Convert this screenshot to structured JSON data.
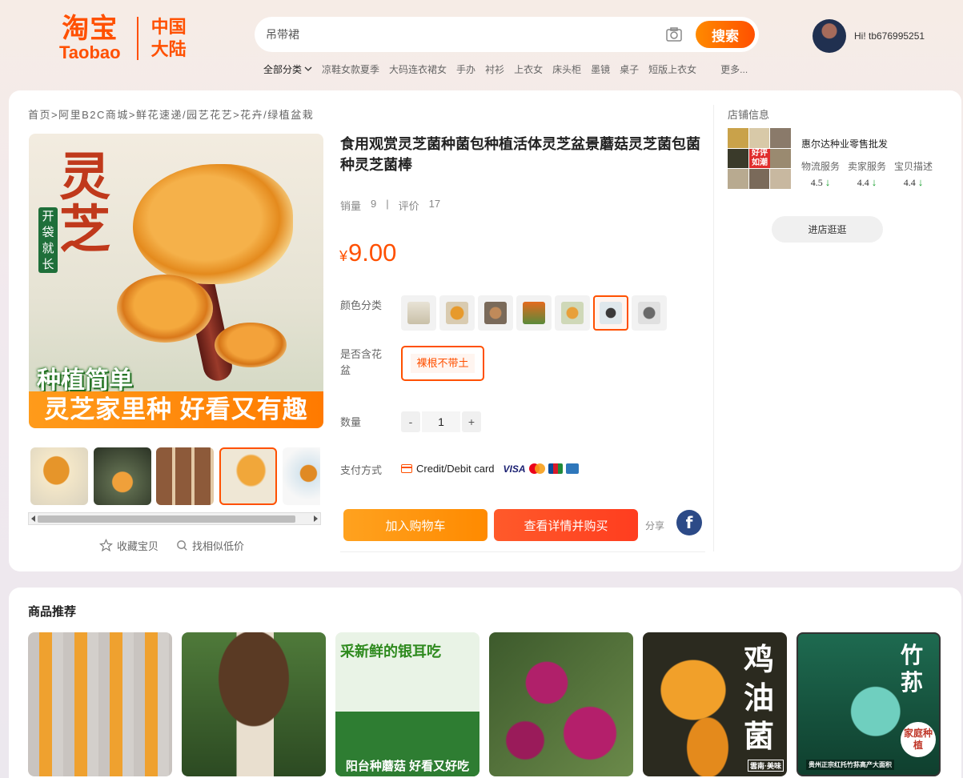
{
  "header": {
    "logo_cn": "淘宝",
    "logo_en": "Taobao",
    "region": [
      "中国",
      "大陆"
    ],
    "search_placeholder": "吊带裙",
    "search_button": "搜索",
    "categories_all": "全部分类",
    "keywords": [
      "凉鞋女款夏季",
      "大码连衣裙女",
      "手办",
      "衬衫",
      "上衣女",
      "床头柜",
      "墨镜",
      "桌子",
      "短版上衣女"
    ],
    "more": "更多...",
    "user_greeting": "Hi! tb676995251"
  },
  "breadcrumb": "首页>阿里B2C商城>鲜花速递/园艺花艺>花卉/绿植盆栽",
  "main_image": {
    "sign": "开袋就长",
    "title": "灵芝",
    "slogan": "种植简单",
    "banner": "灵芝家里种 好看又有趣"
  },
  "thumbnail_count": 5,
  "selected_thumbnail": 4,
  "favorite": "收藏宝贝",
  "similar": "找相似低价",
  "product": {
    "title": "食用观赏灵芝菌种菌包种植活体灵芝盆景蘑菇灵芝菌包菌种灵芝菌棒",
    "sales_label": "销量",
    "sales_value": "9",
    "reviews_label": "评价",
    "reviews_value": "17",
    "currency": "¥",
    "price": "9.00",
    "color_label": "颜色分类",
    "swatch_count": 7,
    "selected_swatch": 6,
    "pot_label": "是否含花盆",
    "pot_option": "裸根不带土",
    "qty_label": "数量",
    "qty_minus": "-",
    "qty_value": "1",
    "qty_plus": "+",
    "pay_label": "支付方式",
    "pay_method": "Credit/Debit card",
    "visa": "VISA",
    "add_cart": "加入购物车",
    "buy": "查看详情并购买",
    "share": "分享",
    "facebook": "f"
  },
  "store": {
    "section_title": "店铺信息",
    "badge": "好评如潮",
    "name": "惠尔达种业零售批发",
    "ratings": [
      {
        "label": "物流服务",
        "value": "4.5"
      },
      {
        "label": "卖家服务",
        "value": "4.4"
      },
      {
        "label": "宝贝描述",
        "value": "4.4"
      }
    ],
    "visit": "进店逛逛"
  },
  "recommend": {
    "title": "商品推荐",
    "r3_top": "采新鲜的银耳吃",
    "r3_bottom": "阳台种蘑菇 好看又好吃",
    "r5_title": "鸡油菌",
    "r5_sub": "雲南·美味",
    "r6_title": "竹荪",
    "r6_badge": "家庭种植",
    "r6_sub": "贵州正宗红托竹荪高产大面积"
  },
  "colors": {
    "accent": "#ff5000",
    "price": "#ff5000",
    "cart_button": "#ff9a1a",
    "buy_button": "#ff4a24",
    "facebook": "#2c4a87",
    "rating_down": "#19a030"
  }
}
